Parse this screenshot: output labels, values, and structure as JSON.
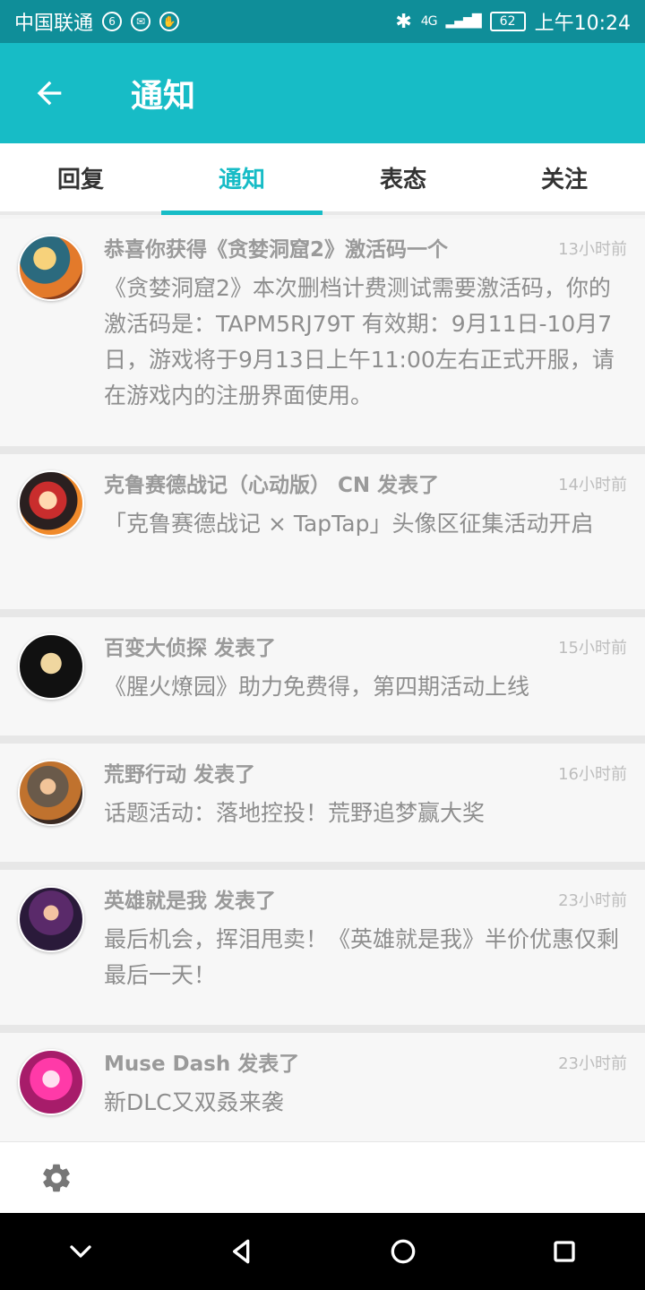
{
  "status": {
    "carrier": "中国联通",
    "network": "4G",
    "battery": "62",
    "time": "上午10:24"
  },
  "header": {
    "back_icon": "arrow-left-icon",
    "title": "通知"
  },
  "tabs": [
    {
      "label": "回复",
      "active": false
    },
    {
      "label": "通知",
      "active": true
    },
    {
      "label": "表态",
      "active": false
    },
    {
      "label": "关注",
      "active": false
    }
  ],
  "notifications": [
    {
      "title": "恭喜你获得《贪婪洞窟2》激活码一个",
      "time": "13小时前",
      "content": "《贪婪洞窟2》本次删档计费测试需要激活码，你的激活码是：TAPM5RJ79T 有效期：9月11日-10月7日，游戏将于9月13日上午11:00左右正式开服，请在游戏内的注册界面使用。"
    },
    {
      "title": "克鲁赛德战记（心动版） CN 发表了",
      "time": "14小时前",
      "content": "「克鲁赛德战记 × TapTap」头像区征集活动开启"
    },
    {
      "title": "百变大侦探 发表了",
      "time": "15小时前",
      "content": "《腥火燎园》助力免费得，第四期活动上线"
    },
    {
      "title": "荒野行动 发表了",
      "time": "16小时前",
      "content": "话题活动：落地控投！荒野追梦赢大奖"
    },
    {
      "title": "英雄就是我 发表了",
      "time": "23小时前",
      "content": "最后机会，挥泪甩卖！《英雄就是我》半价优惠仅剩最后一天！"
    },
    {
      "title": "Muse Dash 发表了",
      "time": "23小时前",
      "content": "新DLC又双叒来袭"
    }
  ],
  "toolbar": {
    "settings_icon": "gear-icon"
  },
  "colors": {
    "accent": "#17bcc6",
    "status_bar": "#0f8e99"
  }
}
